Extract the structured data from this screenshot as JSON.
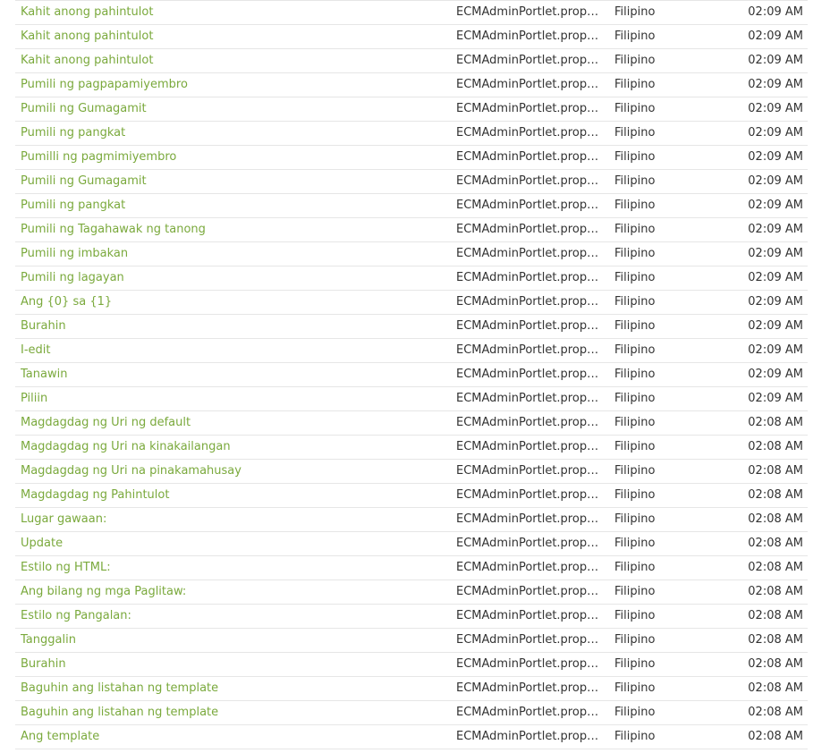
{
  "colors": {
    "link": "#7aa93c",
    "text": "#333333",
    "divider": "#e6e6e6"
  },
  "rows": [
    {
      "label": "Kahit anong pahintulot",
      "file": "ECMAdminPortlet.proper...",
      "language": "Filipino",
      "time": "02:09 AM"
    },
    {
      "label": "Kahit anong pahintulot",
      "file": "ECMAdminPortlet.proper...",
      "language": "Filipino",
      "time": "02:09 AM"
    },
    {
      "label": "Kahit anong pahintulot",
      "file": "ECMAdminPortlet.proper...",
      "language": "Filipino",
      "time": "02:09 AM"
    },
    {
      "label": "Pumili ng pagpapamiyembro",
      "file": "ECMAdminPortlet.proper...",
      "language": "Filipino",
      "time": "02:09 AM"
    },
    {
      "label": "Pumili ng Gumagamit",
      "file": "ECMAdminPortlet.proper...",
      "language": "Filipino",
      "time": "02:09 AM"
    },
    {
      "label": "Pumili ng pangkat",
      "file": "ECMAdminPortlet.proper...",
      "language": "Filipino",
      "time": "02:09 AM"
    },
    {
      "label": "Pumilli ng pagmimiyembro",
      "file": "ECMAdminPortlet.proper...",
      "language": "Filipino",
      "time": "02:09 AM"
    },
    {
      "label": "Pumili ng Gumagamit",
      "file": "ECMAdminPortlet.proper...",
      "language": "Filipino",
      "time": "02:09 AM"
    },
    {
      "label": "Pumili ng pangkat",
      "file": "ECMAdminPortlet.proper...",
      "language": "Filipino",
      "time": "02:09 AM"
    },
    {
      "label": "Pumili ng Tagahawak ng tanong",
      "file": "ECMAdminPortlet.proper...",
      "language": "Filipino",
      "time": "02:09 AM"
    },
    {
      "label": "Pumili ng imbakan",
      "file": "ECMAdminPortlet.proper...",
      "language": "Filipino",
      "time": "02:09 AM"
    },
    {
      "label": "Pumili ng lagayan",
      "file": "ECMAdminPortlet.proper...",
      "language": "Filipino",
      "time": "02:09 AM"
    },
    {
      "label": "Ang {0} sa {1}",
      "file": "ECMAdminPortlet.proper...",
      "language": "Filipino",
      "time": "02:09 AM"
    },
    {
      "label": "Burahin",
      "file": "ECMAdminPortlet.proper...",
      "language": "Filipino",
      "time": "02:09 AM"
    },
    {
      "label": "I-edit",
      "file": "ECMAdminPortlet.proper...",
      "language": "Filipino",
      "time": "02:09 AM"
    },
    {
      "label": "Tanawin",
      "file": "ECMAdminPortlet.proper...",
      "language": "Filipino",
      "time": "02:09 AM"
    },
    {
      "label": "Piliin",
      "file": "ECMAdminPortlet.proper...",
      "language": "Filipino",
      "time": "02:09 AM"
    },
    {
      "label": "Magdagdag ng Uri ng default",
      "file": "ECMAdminPortlet.proper...",
      "language": "Filipino",
      "time": "02:08 AM"
    },
    {
      "label": "Magdagdag ng Uri na kinakailangan",
      "file": "ECMAdminPortlet.proper...",
      "language": "Filipino",
      "time": "02:08 AM"
    },
    {
      "label": "Magdagdag ng Uri na pinakamahusay",
      "file": "ECMAdminPortlet.proper...",
      "language": "Filipino",
      "time": "02:08 AM"
    },
    {
      "label": "Magdagdag ng Pahintulot",
      "file": "ECMAdminPortlet.proper...",
      "language": "Filipino",
      "time": "02:08 AM"
    },
    {
      "label": "Lugar gawaan:",
      "file": "ECMAdminPortlet.proper...",
      "language": "Filipino",
      "time": "02:08 AM"
    },
    {
      "label": "Update",
      "file": "ECMAdminPortlet.proper...",
      "language": "Filipino",
      "time": "02:08 AM"
    },
    {
      "label": "Estilo ng HTML:",
      "file": "ECMAdminPortlet.proper...",
      "language": "Filipino",
      "time": "02:08 AM"
    },
    {
      "label": "Ang bilang ng mga Paglitaw:",
      "file": "ECMAdminPortlet.proper...",
      "language": "Filipino",
      "time": "02:08 AM"
    },
    {
      "label": "Estilo ng Pangalan:",
      "file": "ECMAdminPortlet.proper...",
      "language": "Filipino",
      "time": "02:08 AM"
    },
    {
      "label": "Tanggalin",
      "file": "ECMAdminPortlet.proper...",
      "language": "Filipino",
      "time": "02:08 AM"
    },
    {
      "label": "Burahin",
      "file": "ECMAdminPortlet.proper...",
      "language": "Filipino",
      "time": "02:08 AM"
    },
    {
      "label": "Baguhin ang listahan ng template",
      "file": "ECMAdminPortlet.proper...",
      "language": "Filipino",
      "time": "02:08 AM"
    },
    {
      "label": "Baguhin ang listahan ng template",
      "file": "ECMAdminPortlet.proper...",
      "language": "Filipino",
      "time": "02:08 AM"
    },
    {
      "label": "Ang template",
      "file": "ECMAdminPortlet.proper...",
      "language": "Filipino",
      "time": "02:08 AM"
    }
  ]
}
